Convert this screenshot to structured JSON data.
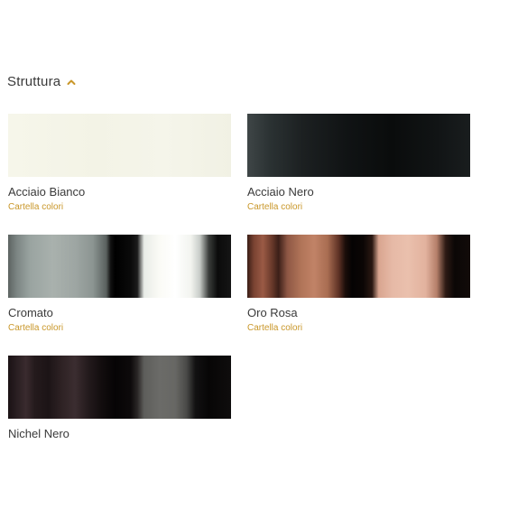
{
  "section": {
    "title": "Struttura",
    "toggle_icon": "chevron-up-icon",
    "accent_color": "#c9972a"
  },
  "finishes": [
    {
      "name": "Acciaio Bianco",
      "link": "Cartella colori"
    },
    {
      "name": "Acciaio Nero",
      "link": "Cartella colori"
    },
    {
      "name": "Cromato",
      "link": "Cartella colori"
    },
    {
      "name": "Oro Rosa",
      "link": "Cartella colori"
    },
    {
      "name": "Nichel Nero",
      "link": ""
    }
  ]
}
